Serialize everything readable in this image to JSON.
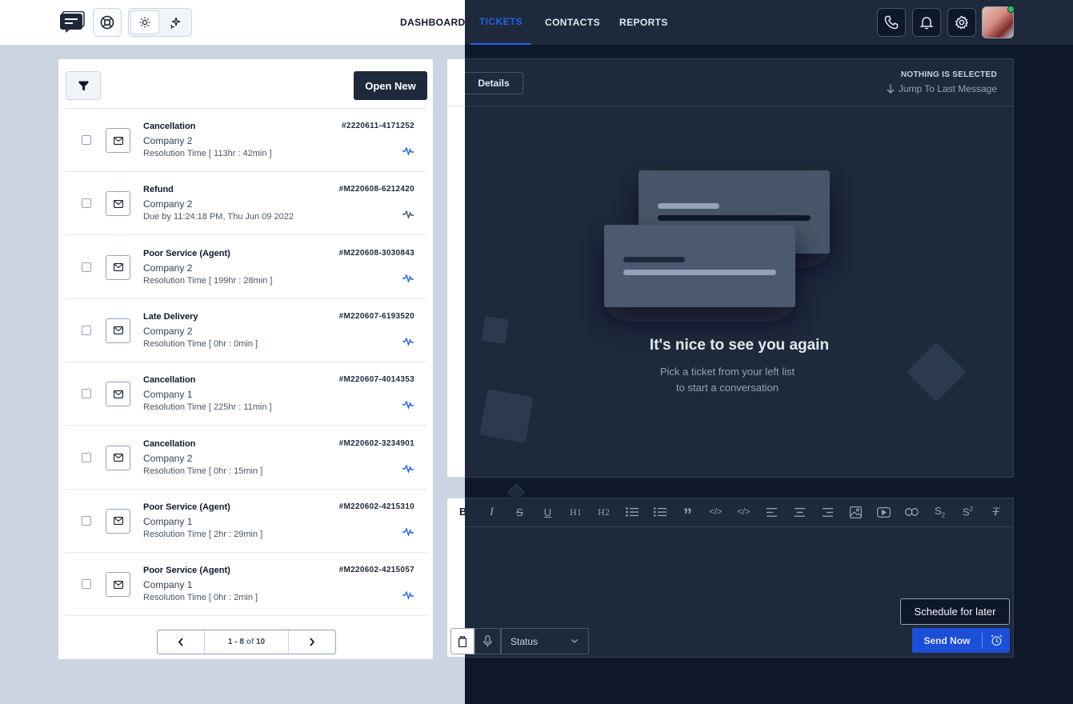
{
  "nav": {
    "dashboard": "DASHBOARD",
    "tickets": "TICKETS",
    "contacts": "CONTACTS",
    "reports": "REPORTS",
    "active_color": "#2563eb"
  },
  "icons": {
    "logo": "chat-logo-icon",
    "help": "lifebuoy-icon",
    "light": "sun-icon",
    "dark": "sparkle-icon",
    "phone": "phone-icon",
    "bell": "bell-icon",
    "settings": "gear-icon"
  },
  "list": {
    "open_new_label": "Open New",
    "tickets": [
      {
        "subject": "Cancellation",
        "company": "Company 2",
        "meta": "Resolution Time [ 113hr : 42min ]",
        "id": "#2220611-4171252"
      },
      {
        "subject": "Refund",
        "company": "Company 2",
        "meta": "Due by 11:24:18 PM, Thu Jun 09 2022",
        "id": "#M220608-6212420"
      },
      {
        "subject": "Poor Service (Agent)",
        "company": "Company 2",
        "meta": "Resolution Time [ 199hr : 28min ]",
        "id": "#M220608-3030843"
      },
      {
        "subject": "Late Delivery",
        "company": "Company 2",
        "meta": "Resolution Time [ 0hr : 0min ]",
        "id": "#M220607-6193520"
      },
      {
        "subject": "Cancellation",
        "company": "Company 1",
        "meta": "Resolution Time [ 225hr : 11min ]",
        "id": "#M220607-4014353"
      },
      {
        "subject": "Cancellation",
        "company": "Company 2",
        "meta": "Resolution Time [ 0hr : 15min ]",
        "id": "#M220602-3234901"
      },
      {
        "subject": "Poor Service (Agent)",
        "company": "Company 1",
        "meta": "Resolution Time [ 2hr : 29min ]",
        "id": "#M220602-4215310"
      },
      {
        "subject": "Poor Service (Agent)",
        "company": "Company 1",
        "meta": "Resolution Time [ 0hr : 2min ]",
        "id": "#M220602-4215057"
      }
    ],
    "pagination": {
      "range": "1 - 8",
      "of_label": "of",
      "total": "10"
    }
  },
  "conversation": {
    "details_tab": "Details",
    "nothing_selected": "NOTHING IS SELECTED",
    "jump_last": "Jump To Last Message",
    "greeting_title": "It's nice to see you again",
    "greeting_line1": "Pick a ticket from your left list",
    "greeting_line2": "to start a conversation"
  },
  "editor": {
    "toolbar": [
      "I",
      "S",
      "U",
      "H1",
      "H2",
      "•",
      "1.",
      "”",
      "</>",
      "</>",
      "left",
      "center",
      "right",
      "image",
      "video",
      "link",
      "S2",
      "S2",
      "Tx"
    ],
    "bold_label": "B",
    "status_label": "Status",
    "schedule_label": "Schedule for later",
    "send_label": "Send Now"
  }
}
